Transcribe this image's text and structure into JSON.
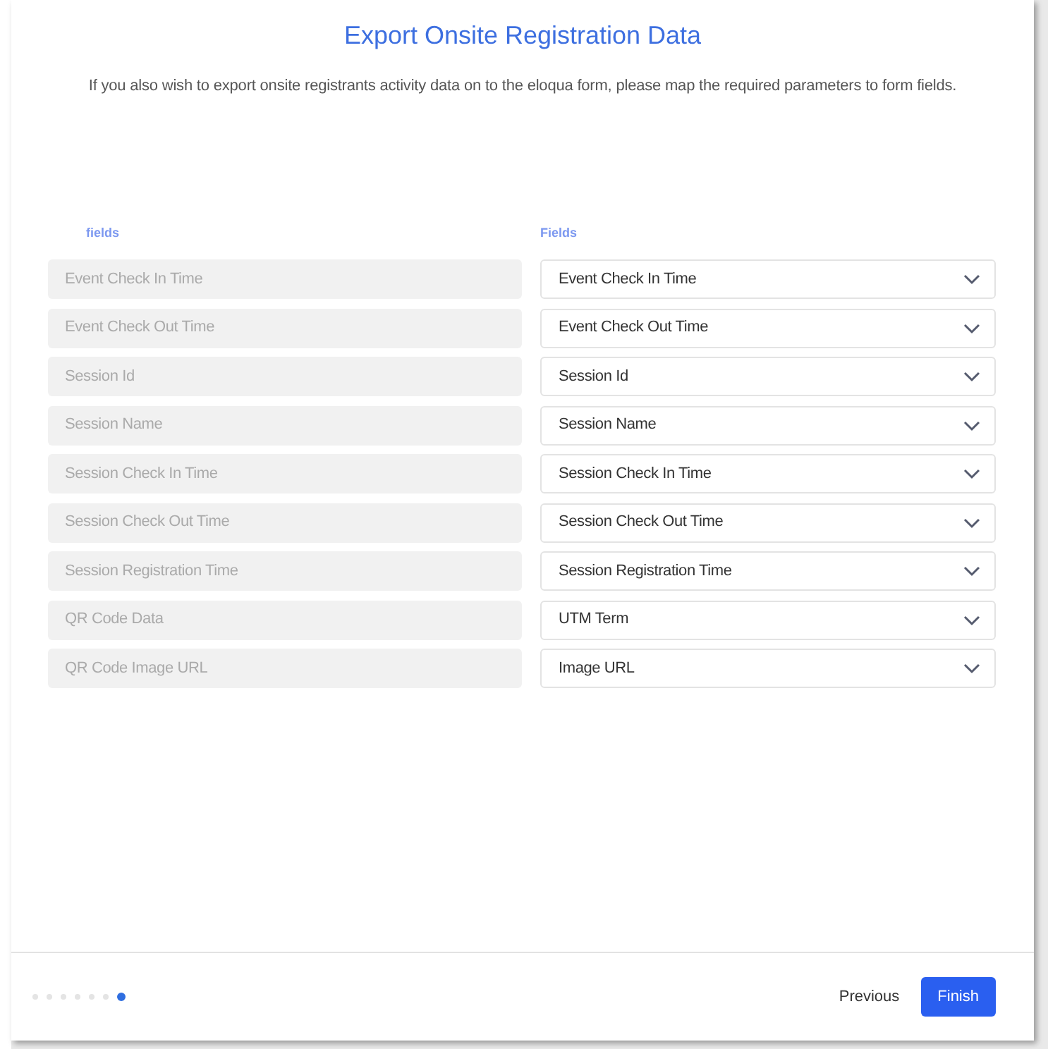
{
  "dialog": {
    "title": "Export Onsite Registration Data",
    "description": "If you also wish to export onsite registrants activity data on to the eloqua form, please map the required parameters to form fields."
  },
  "mapping": {
    "left_header": "fields",
    "right_header": "Fields",
    "rows": [
      {
        "source": "Event Check In Time",
        "target": "Event Check In Time"
      },
      {
        "source": "Event Check Out Time",
        "target": "Event Check Out Time"
      },
      {
        "source": "Session Id",
        "target": "Session Id"
      },
      {
        "source": "Session Name",
        "target": "Session Name"
      },
      {
        "source": "Session Check In Time",
        "target": "Session Check In Time"
      },
      {
        "source": "Session Check Out Time",
        "target": "Session Check Out Time"
      },
      {
        "source": "Session Registration Time",
        "target": "Session Registration Time"
      },
      {
        "source": "QR Code Data",
        "target": "UTM Term"
      },
      {
        "source": "QR Code Image URL",
        "target": "Image URL"
      }
    ]
  },
  "footer": {
    "steps": [
      {
        "selected": false
      },
      {
        "selected": false
      },
      {
        "selected": false
      },
      {
        "selected": false
      },
      {
        "selected": false
      },
      {
        "selected": false
      },
      {
        "selected": true
      }
    ],
    "buttons": [
      {
        "label": "Previous",
        "kind": "secondary"
      },
      {
        "label": "Finish",
        "kind": "primary"
      }
    ]
  }
}
